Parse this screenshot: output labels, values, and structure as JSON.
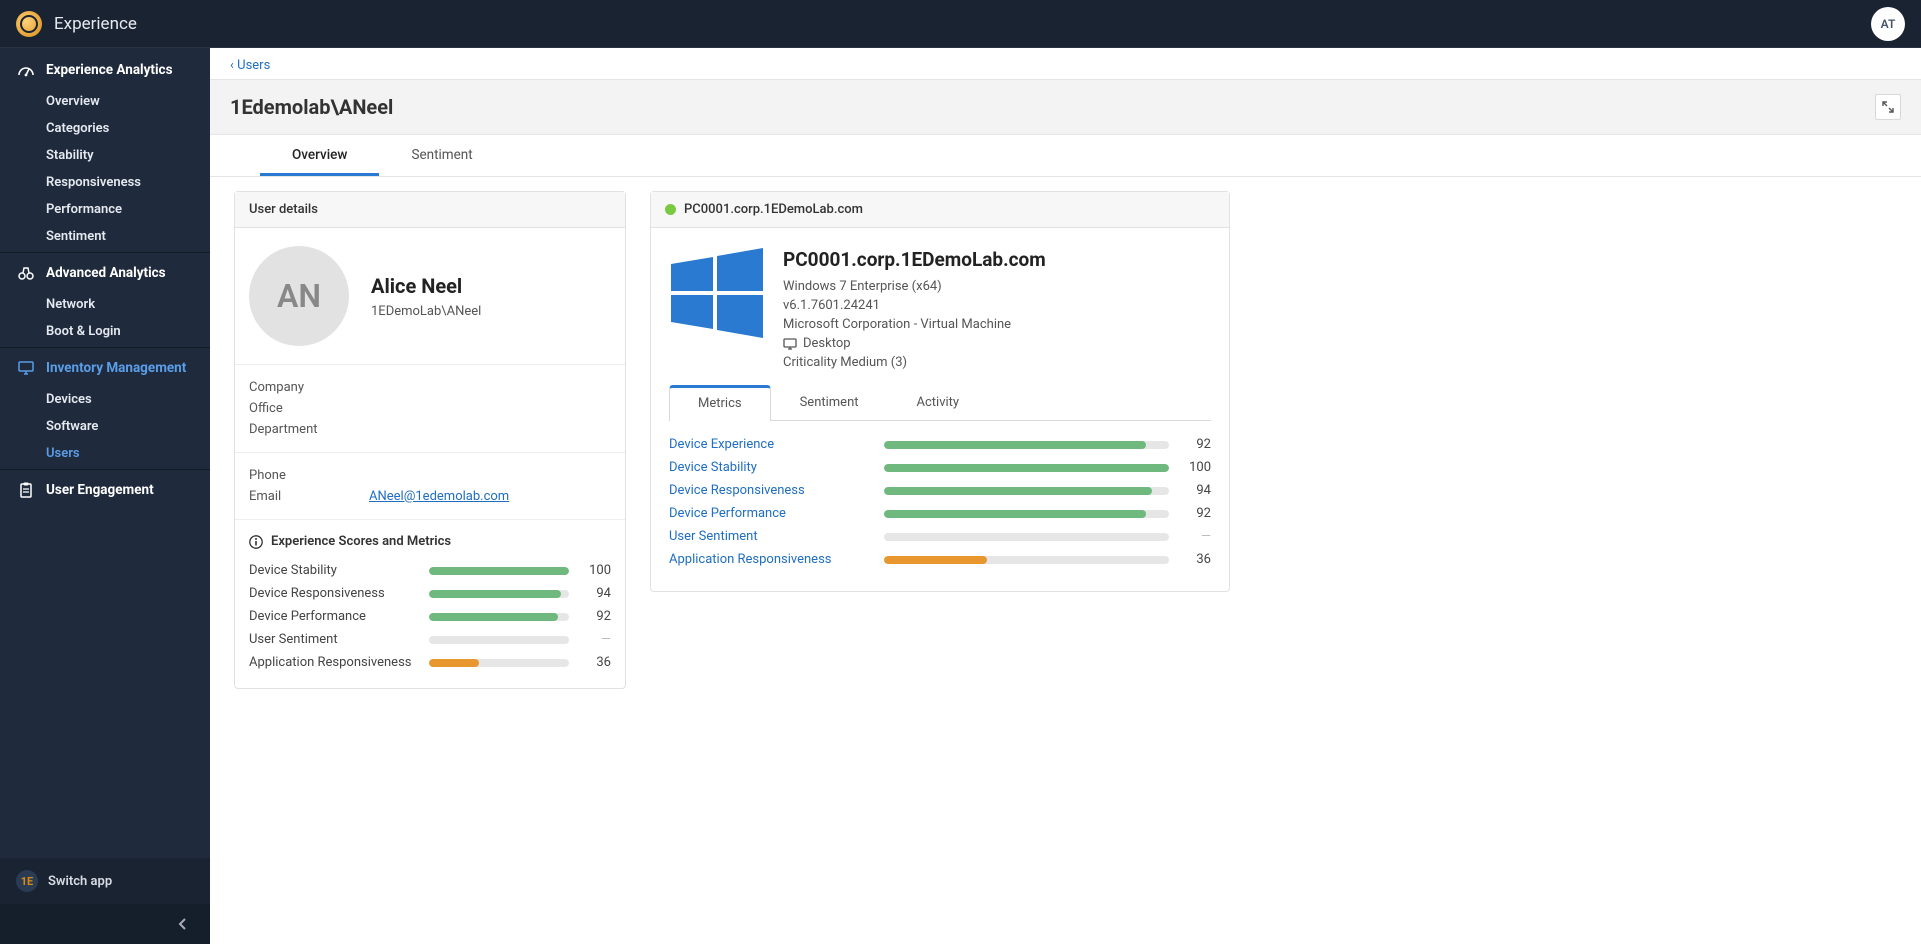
{
  "topbar": {
    "title": "Experience",
    "user_initials": "AT"
  },
  "sidebar": {
    "sections": [
      {
        "icon": "dashboard-icon",
        "title": "Experience Analytics",
        "active": false,
        "items": [
          {
            "label": "Overview",
            "active": false
          },
          {
            "label": "Categories",
            "active": false
          },
          {
            "label": "Stability",
            "active": false
          },
          {
            "label": "Responsiveness",
            "active": false
          },
          {
            "label": "Performance",
            "active": false
          },
          {
            "label": "Sentiment",
            "active": false
          }
        ]
      },
      {
        "icon": "binoculars-icon",
        "title": "Advanced Analytics",
        "active": false,
        "items": [
          {
            "label": "Network",
            "active": false
          },
          {
            "label": "Boot & Login",
            "active": false
          }
        ]
      },
      {
        "icon": "monitor-icon",
        "title": "Inventory Management",
        "active": true,
        "items": [
          {
            "label": "Devices",
            "active": false
          },
          {
            "label": "Software",
            "active": false
          },
          {
            "label": "Users",
            "active": true
          }
        ]
      },
      {
        "icon": "clipboard-icon",
        "title": "User Engagement",
        "active": false,
        "items": []
      }
    ],
    "switch_app": "Switch app"
  },
  "breadcrumb": {
    "parent": "Users"
  },
  "page_title": "1Edemolab\\ANeel",
  "main_tabs": [
    {
      "label": "Overview",
      "active": true
    },
    {
      "label": "Sentiment",
      "active": false
    }
  ],
  "user_card": {
    "header": "User details",
    "initials": "AN",
    "name": "Alice Neel",
    "domain": "1EDemoLab\\ANeel",
    "company_label": "Company",
    "office_label": "Office",
    "department_label": "Department",
    "phone_label": "Phone",
    "email_label": "Email",
    "email_value": "ANeel@1edemolab.com",
    "scores_title": "Experience Scores and Metrics",
    "scores": [
      {
        "name": "Device Stability",
        "value": 100,
        "pct": 100,
        "color": "green"
      },
      {
        "name": "Device Responsiveness",
        "value": 94,
        "pct": 94,
        "color": "green"
      },
      {
        "name": "Device Performance",
        "value": 92,
        "pct": 92,
        "color": "green"
      },
      {
        "name": "User Sentiment",
        "value": null,
        "pct": 0,
        "color": "none"
      },
      {
        "name": "Application Responsiveness",
        "value": 36,
        "pct": 36,
        "color": "orange"
      }
    ]
  },
  "device_card": {
    "fqdn": "PC0001.corp.1EDemoLab.com",
    "header_fqdn": "PC0001.corp.1EDemoLab.com",
    "os": "Windows 7 Enterprise (x64)",
    "version": "v6.1.7601.24241",
    "hardware": "Microsoft Corporation - Virtual Machine",
    "form_factor": "Desktop",
    "criticality": "Criticality Medium (3)",
    "sub_tabs": [
      {
        "label": "Metrics",
        "active": true
      },
      {
        "label": "Sentiment",
        "active": false
      },
      {
        "label": "Activity",
        "active": false
      }
    ],
    "metrics": [
      {
        "name": "Device Experience",
        "value": 92,
        "pct": 92,
        "color": "green",
        "link": true
      },
      {
        "name": "Device Stability",
        "value": 100,
        "pct": 100,
        "color": "green",
        "link": true
      },
      {
        "name": "Device Responsiveness",
        "value": 94,
        "pct": 94,
        "color": "green",
        "link": true
      },
      {
        "name": "Device Performance",
        "value": 92,
        "pct": 92,
        "color": "green",
        "link": true
      },
      {
        "name": "User Sentiment",
        "value": null,
        "pct": 0,
        "color": "none",
        "link": true
      },
      {
        "name": "Application Responsiveness",
        "value": 36,
        "pct": 36,
        "color": "orange",
        "link": true
      }
    ]
  },
  "chart_data": [
    {
      "type": "bar",
      "title": "Experience Scores and Metrics (User)",
      "categories": [
        "Device Stability",
        "Device Responsiveness",
        "Device Performance",
        "User Sentiment",
        "Application Responsiveness"
      ],
      "values": [
        100,
        94,
        92,
        null,
        36
      ],
      "ylim": [
        0,
        100
      ]
    },
    {
      "type": "bar",
      "title": "Device Metrics (PC0001.corp.1EDemoLab.com)",
      "categories": [
        "Device Experience",
        "Device Stability",
        "Device Responsiveness",
        "Device Performance",
        "User Sentiment",
        "Application Responsiveness"
      ],
      "values": [
        92,
        100,
        94,
        92,
        null,
        36
      ],
      "ylim": [
        0,
        100
      ]
    }
  ]
}
